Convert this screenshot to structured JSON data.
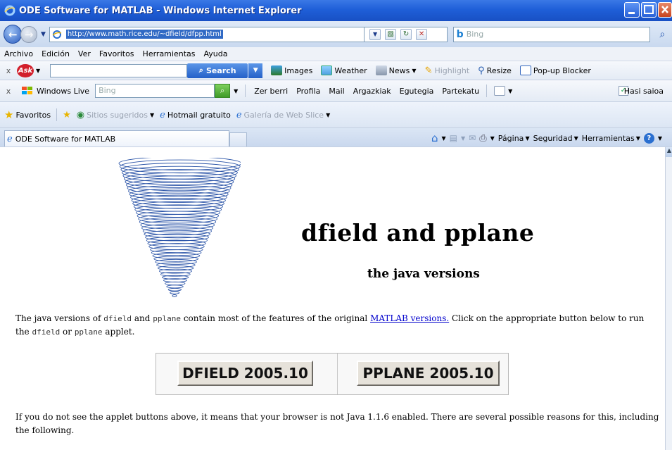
{
  "window": {
    "title": "ODE Software for MATLAB - Windows Internet Explorer"
  },
  "address": {
    "url": "http://www.math.rice.edu/~dfield/dfpp.html",
    "search_placeholder": "Bing"
  },
  "menu": [
    "Archivo",
    "Edición",
    "Ver",
    "Favoritos",
    "Herramientas",
    "Ayuda"
  ],
  "ask_toolbar": {
    "search_label": "Search",
    "images": "Images",
    "weather": "Weather",
    "news": "News",
    "highlight": "Highlight",
    "resize": "Resize",
    "popup": "Pop-up Blocker"
  },
  "live_toolbar": {
    "brand": "Windows Live",
    "search_placeholder": "Bing",
    "links": [
      "Zer berri",
      "Profila",
      "Mail",
      "Argazkiak",
      "Egutegia",
      "Partekatu"
    ],
    "signout": "Hasi saioa"
  },
  "favorites_bar": {
    "favorites": "Favoritos",
    "suggested": "Sitios sugeridos",
    "hotmail": "Hotmail gratuito",
    "webslice": "Galería de Web Slice"
  },
  "tabs": [
    {
      "label": "ODE Software for MATLAB"
    }
  ],
  "command_bar": {
    "page": "Página",
    "security": "Seguridad",
    "tools": "Herramientas"
  },
  "content": {
    "heading": "dfield and pplane",
    "subheading": "the java versions",
    "p1_a": "The java versions of ",
    "dfield": "dfield",
    "and": " and ",
    "pplane": "pplane",
    "p1_b": " contain most of the features of the original ",
    "link": "MATLAB versions.",
    "p1_c": " Click on the appropriate button below to run the ",
    "or": " or ",
    "applet": " applet.",
    "btn_dfield": "DFIELD 2005.10",
    "btn_pplane": "PPLANE 2005.10",
    "p2": "If you do not see the applet buttons above, it means that your browser is not Java 1.1.6 enabled.  There are several possible reasons for this, including the following."
  },
  "colors": {
    "titlebar": "#1f5fd8",
    "link": "#0000cc",
    "funnel": "#2c55a8"
  }
}
